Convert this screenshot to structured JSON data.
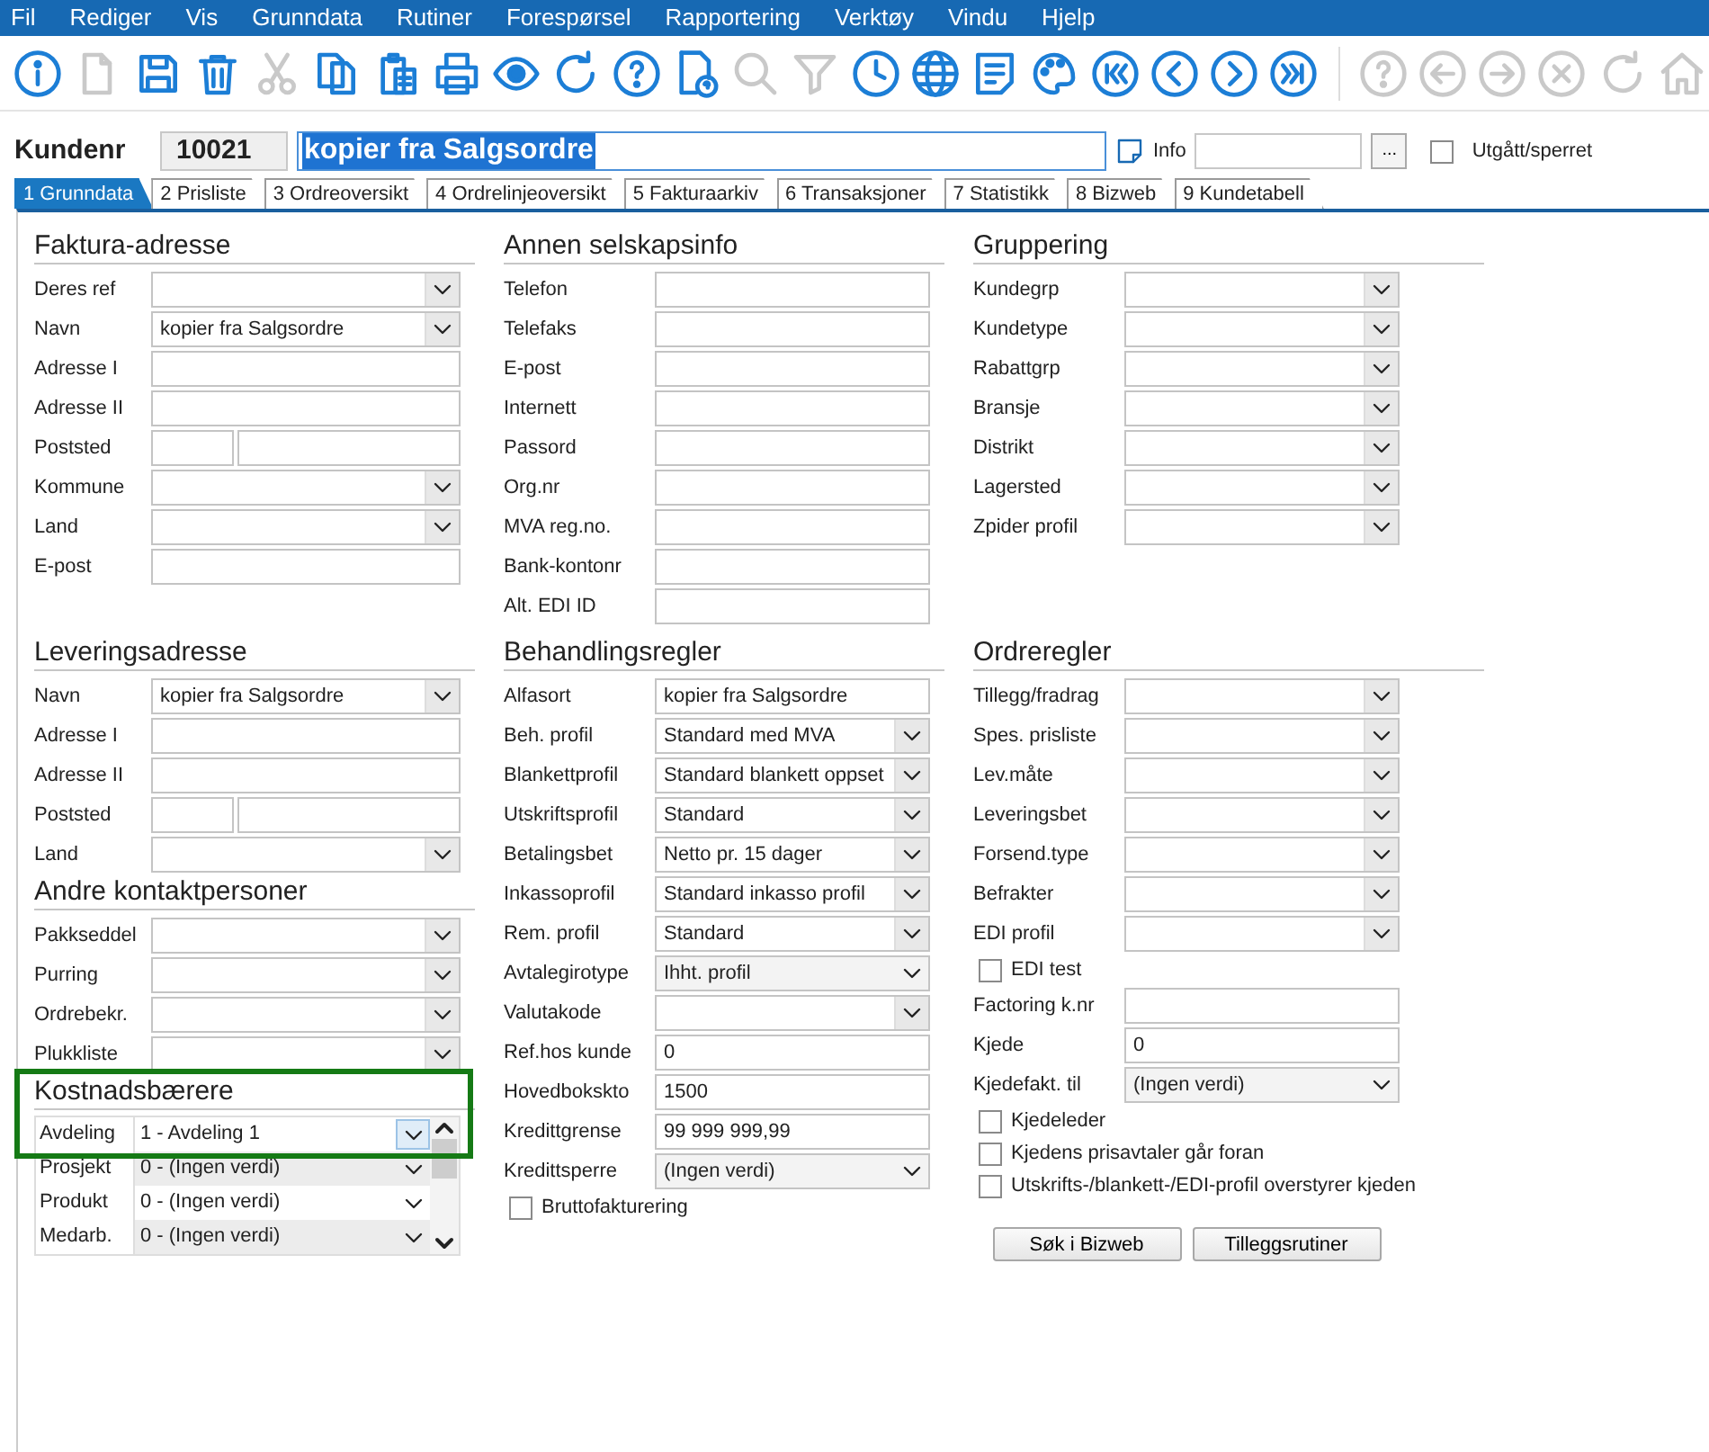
{
  "menu": [
    "Fil",
    "Rediger",
    "Vis",
    "Grunndata",
    "Rutiner",
    "Forespørsel",
    "Rapportering",
    "Verktøy",
    "Vindu",
    "Hjelp"
  ],
  "toolbar": [
    {
      "disabled": false
    },
    {
      "disabled": true
    },
    {
      "disabled": false
    },
    {
      "disabled": false
    },
    {
      "disabled": true
    },
    {
      "disabled": false
    },
    {
      "disabled": false
    },
    {
      "disabled": false
    },
    {
      "disabled": false
    },
    {
      "disabled": false
    },
    {
      "disabled": false
    },
    {
      "disabled": false
    },
    {
      "disabled": true
    },
    {
      "disabled": true
    },
    {
      "disabled": false
    },
    {
      "disabled": false
    },
    {
      "disabled": false
    },
    {
      "disabled": false
    },
    {
      "disabled": false
    },
    {
      "disabled": false
    },
    {
      "disabled": false
    },
    {
      "disabled": false
    },
    {
      "disabled": true
    },
    {
      "disabled": true
    },
    {
      "disabled": true
    },
    {
      "disabled": true
    },
    {
      "disabled": true
    },
    {
      "disabled": true
    }
  ],
  "header": {
    "label": "Kundenr",
    "number": "10021",
    "name": "kopier fra Salgsordre",
    "name_selected": true,
    "info_label": "Info",
    "browse": "...",
    "blocked": {
      "label": "Utgått/sperret",
      "checked": false
    }
  },
  "tabs": [
    {
      "label": "1 Grunndata",
      "selected": true
    },
    {
      "label": "2 Prisliste",
      "selected": false
    },
    {
      "label": "3 Ordreoversikt",
      "selected": false
    },
    {
      "label": "4 Ordrelinjeoversikt",
      "selected": false
    },
    {
      "label": "5 Fakturaarkiv",
      "selected": false
    },
    {
      "label": "6 Transaksjoner",
      "selected": false
    },
    {
      "label": "7 Statistikk",
      "selected": false
    },
    {
      "label": "8 Bizweb",
      "selected": false
    },
    {
      "label": "9 Kundetabell",
      "selected": false
    }
  ],
  "columns": [
    {
      "sections": [
        {
          "title": "Faktura-adresse",
          "rows": [
            {
              "kind": "combo",
              "label": "Deres ref"
            },
            {
              "kind": "combo",
              "label": "Navn",
              "value": "kopier fra Salgsordre"
            },
            {
              "kind": "text",
              "label": "Adresse I"
            },
            {
              "kind": "text",
              "label": "Adresse II"
            },
            {
              "kind": "split",
              "label": "Poststed"
            },
            {
              "kind": "combo",
              "label": "Kommune"
            },
            {
              "kind": "combo",
              "label": "Land"
            },
            {
              "kind": "text",
              "label": "E-post"
            }
          ]
        },
        {
          "title": "Leveringsadresse",
          "rows": [
            {
              "kind": "combo",
              "label": "Navn",
              "value": "kopier fra Salgsordre"
            },
            {
              "kind": "text",
              "label": "Adresse I"
            },
            {
              "kind": "text",
              "label": "Adresse II"
            },
            {
              "kind": "split",
              "label": "Poststed"
            },
            {
              "kind": "combo",
              "label": "Land"
            }
          ]
        },
        {
          "title": "Andre kontaktpersoner",
          "rows": [
            {
              "kind": "combo",
              "label": "Pakkseddel"
            },
            {
              "kind": "combo",
              "label": "Purring"
            },
            {
              "kind": "combo",
              "label": "Ordrebekr."
            },
            {
              "kind": "combo",
              "label": "Plukkliste"
            }
          ]
        },
        {
          "title": "Kostnadsbærere",
          "highlighted": true,
          "grid": [
            {
              "label": "Avdeling",
              "value": "1 - Avdeling 1",
              "selected": true
            },
            {
              "label": "Prosjekt",
              "value": "0 - (Ingen verdi)",
              "selected": false
            },
            {
              "label": "Produkt",
              "value": "0 - (Ingen verdi)",
              "selected": false
            },
            {
              "label": "Medarb.",
              "value": "0 - (Ingen verdi)",
              "selected": false
            }
          ]
        }
      ]
    },
    {
      "sections": [
        {
          "title": "Annen selskapsinfo",
          "rows": [
            {
              "kind": "text",
              "label": "Telefon"
            },
            {
              "kind": "text",
              "label": "Telefaks"
            },
            {
              "kind": "text",
              "label": "E-post"
            },
            {
              "kind": "text",
              "label": "Internett"
            },
            {
              "kind": "text",
              "label": "Passord"
            },
            {
              "kind": "text",
              "label": "Org.nr"
            },
            {
              "kind": "text",
              "label": "MVA reg.no."
            },
            {
              "kind": "text",
              "label": "Bank-kontonr"
            },
            {
              "kind": "text",
              "label": "Alt. EDI ID"
            }
          ]
        },
        {
          "title": "Behandlingsregler",
          "rows": [
            {
              "kind": "text",
              "label": "Alfasort",
              "value": "kopier fra Salgsordre"
            },
            {
              "kind": "combo",
              "label": "Beh. profil",
              "value": "Standard med MVA"
            },
            {
              "kind": "combo",
              "label": "Blankettprofil",
              "value": "Standard blankett oppset"
            },
            {
              "kind": "combo",
              "label": "Utskriftsprofil",
              "value": "Standard"
            },
            {
              "kind": "combo",
              "label": "Betalingsbet",
              "value": "Netto pr. 15 dager"
            },
            {
              "kind": "combo",
              "label": "Inkassoprofil",
              "value": "Standard inkasso profil"
            },
            {
              "kind": "combo",
              "label": "Rem. profil",
              "value": "Standard"
            },
            {
              "kind": "flat",
              "label": "Avtalegirotype",
              "value": "Ihht. profil"
            },
            {
              "kind": "combo",
              "label": "Valutakode"
            },
            {
              "kind": "text",
              "label": "Ref.hos kunde",
              "value": "0"
            },
            {
              "kind": "text",
              "label": "Hovedbokskto",
              "value": "1500"
            },
            {
              "kind": "text",
              "label": "Kredittgrense",
              "value": "99 999 999,99"
            },
            {
              "kind": "flat",
              "label": "Kredittsperre",
              "value": "(Ingen verdi)"
            },
            {
              "kind": "check",
              "label": "Bruttofakturering",
              "checked": false
            }
          ]
        }
      ]
    },
    {
      "sections": [
        {
          "title": "Gruppering",
          "rows": [
            {
              "kind": "combo",
              "label": "Kundegrp"
            },
            {
              "kind": "combo",
              "label": "Kundetype"
            },
            {
              "kind": "combo",
              "label": "Rabattgrp"
            },
            {
              "kind": "combo",
              "label": "Bransje"
            },
            {
              "kind": "combo",
              "label": "Distrikt"
            },
            {
              "kind": "combo",
              "label": "Lagersted"
            },
            {
              "kind": "combo",
              "label": "Zpider profil"
            }
          ]
        },
        {
          "title": "Ordreregler",
          "rows": [
            {
              "kind": "combo",
              "label": "Tillegg/fradrag"
            },
            {
              "kind": "combo",
              "label": "Spes. prisliste"
            },
            {
              "kind": "combo",
              "label": "Lev.måte"
            },
            {
              "kind": "combo",
              "label": "Leveringsbet"
            },
            {
              "kind": "combo",
              "label": "Forsend.type"
            },
            {
              "kind": "combo",
              "label": "Befrakter"
            },
            {
              "kind": "combo",
              "label": "EDI profil"
            },
            {
              "kind": "check",
              "label": "EDI test",
              "checked": false
            },
            {
              "kind": "text",
              "label": "Factoring k.nr"
            },
            {
              "kind": "text",
              "label": "Kjede",
              "value": "0"
            },
            {
              "kind": "flat",
              "label": "Kjedefakt. til",
              "value": "(Ingen verdi)"
            },
            {
              "kind": "check",
              "label": "Kjedeleder",
              "checked": false
            },
            {
              "kind": "check",
              "label": "Kjedens prisavtaler går foran",
              "checked": false
            },
            {
              "kind": "check",
              "label": "Utskrifts-/blankett-/EDI-profil overstyrer kjeden",
              "checked": false
            },
            {
              "kind": "buttons",
              "buttons": [
                "Søk i Bizweb",
                "Tilleggsrutiner"
              ]
            }
          ]
        }
      ]
    }
  ]
}
